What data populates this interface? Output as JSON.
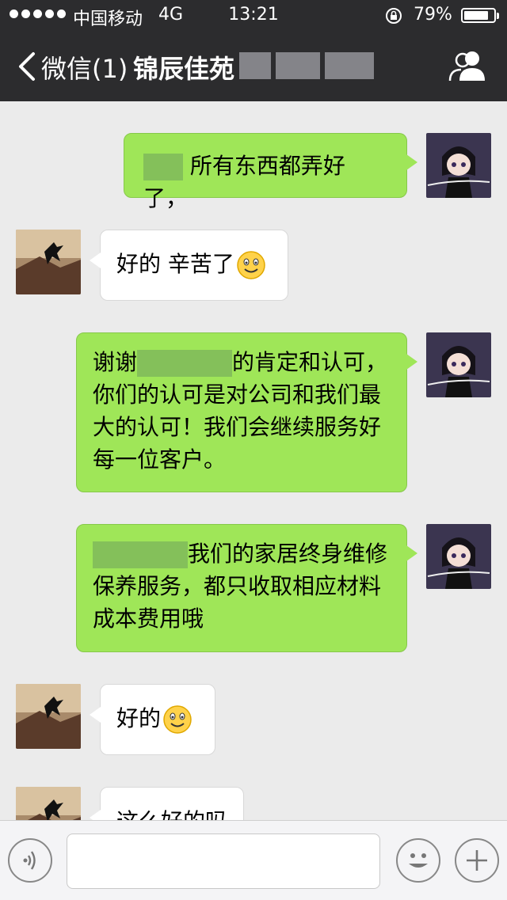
{
  "status_bar": {
    "carrier": "中国移动",
    "network": "4G",
    "time": "13:21",
    "battery_percent": "79%",
    "battery_level": 0.79
  },
  "nav": {
    "back_label": "微信(1)",
    "title": "锦辰佳苑"
  },
  "messages": [
    {
      "side": "me",
      "parts": [
        "所有东西都弄好了，"
      ]
    },
    {
      "side": "them",
      "parts": [
        "好的 辛苦了"
      ],
      "emoji": "smile-emoji"
    },
    {
      "side": "me",
      "parts": [
        "谢谢",
        "的肯定和认可，",
        "你们的认可是对公司和我们最",
        "大的认可！我们会继续服务好",
        "每一位客户。"
      ]
    },
    {
      "side": "me",
      "parts": [
        "我们的家居终身维修",
        "保养服务，都只收取相应材料",
        "成本费用哦"
      ]
    },
    {
      "side": "them",
      "parts": [
        "好的"
      ],
      "emoji": "smile-emoji"
    },
    {
      "side": "them",
      "parts": [
        "这么好的吗"
      ]
    }
  ],
  "input": {
    "value": "",
    "icons": [
      "voice-icon",
      "emoji-icon",
      "plus-icon"
    ]
  },
  "colors": {
    "nav_bg": "#2c2c2e",
    "chat_bg": "#ebebeb",
    "my_bubble": "#9fe658",
    "their_bubble": "#ffffff"
  }
}
